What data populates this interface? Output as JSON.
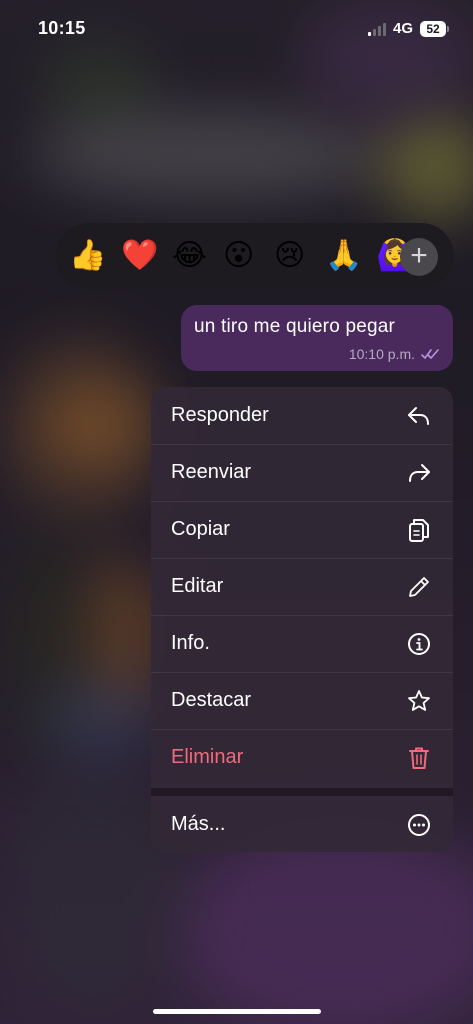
{
  "status_bar": {
    "time": "10:15",
    "network": "4G",
    "battery": "52"
  },
  "reactions": {
    "emojis": [
      "👍",
      "❤️",
      "😂",
      "😮",
      "😢",
      "🙏",
      "🙆‍♀️"
    ],
    "add_label": "+"
  },
  "message": {
    "text": "un tiro me quiero pegar",
    "time": "10:10 p.m.",
    "bubble_color": "#4a2a5c"
  },
  "menu": {
    "items": [
      {
        "label": "Responder",
        "icon": "reply-icon"
      },
      {
        "label": "Reenviar",
        "icon": "forward-icon"
      },
      {
        "label": "Copiar",
        "icon": "copy-icon"
      },
      {
        "label": "Editar",
        "icon": "pencil-icon"
      },
      {
        "label": "Info.",
        "icon": "info-icon"
      },
      {
        "label": "Destacar",
        "icon": "star-icon"
      },
      {
        "label": "Eliminar",
        "icon": "trash-icon",
        "color": "#ef6b7d"
      },
      {
        "label": "Más...",
        "icon": "more-icon"
      }
    ]
  }
}
